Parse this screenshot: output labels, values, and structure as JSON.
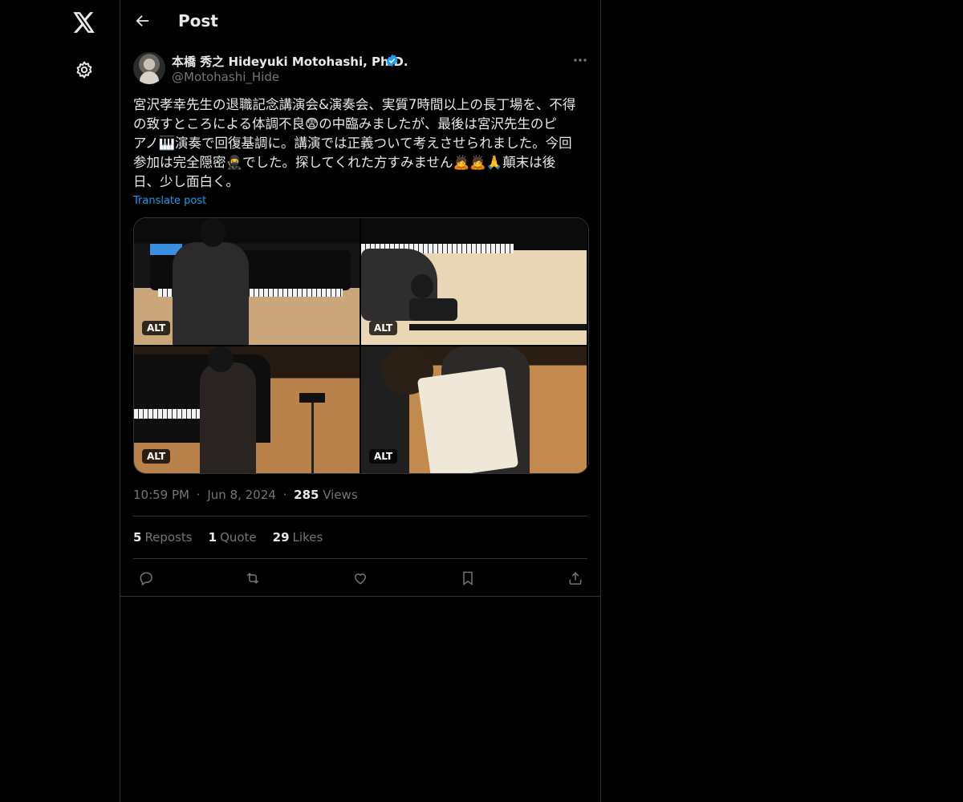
{
  "nav": {
    "items": [
      {
        "icon": "x-logo-icon"
      },
      {
        "icon": "gear-icon"
      }
    ]
  },
  "header": {
    "title": "Post",
    "back_icon": "arrow-left-icon"
  },
  "post": {
    "author_name": "本橋 秀之 Hideyuki Motohashi, Ph.D.",
    "author_handle": "@Motohashi_Hide",
    "verified_icon": "verified-badge-icon",
    "verified_color": "#1d9bf0",
    "more_icon": "more-dots-icon",
    "text_lines": [
      "宮沢孝幸先生の退職記念講演会&演奏会、実質7時間以上の長丁場を、不得",
      "の致すところによる体調不良😨の中臨みましたが、最後は宮沢先生のピ",
      "アノ🎹演奏で回復基調に。講演では正義ついて考えさせられました。今回",
      "参加は完全隠密🥷でした。探してくれた方すみません🙇🙇🙏顛末は後",
      "日、少し面白く。"
    ],
    "translate_label": "Translate post",
    "media": [
      {
        "alt_label": "ALT"
      },
      {
        "alt_label": "ALT"
      },
      {
        "alt_label": "ALT"
      },
      {
        "alt_label": "ALT"
      }
    ],
    "time": "10:59 PM",
    "separator": "·",
    "date": "Jun 8, 2024",
    "views_count": "285",
    "views_label": "Views",
    "stats": [
      {
        "count": "5",
        "label": "Reposts"
      },
      {
        "count": "1",
        "label": "Quote"
      },
      {
        "count": "29",
        "label": "Likes"
      }
    ],
    "actions": [
      {
        "icon": "reply-icon"
      },
      {
        "icon": "repost-icon"
      },
      {
        "icon": "like-icon"
      },
      {
        "icon": "bookmark-icon"
      },
      {
        "icon": "share-icon"
      }
    ]
  },
  "colors": {
    "background": "#000000",
    "text": "#e7e9ea",
    "muted": "#71767b",
    "accent": "#1d9bf0",
    "border": "#2f3336"
  }
}
